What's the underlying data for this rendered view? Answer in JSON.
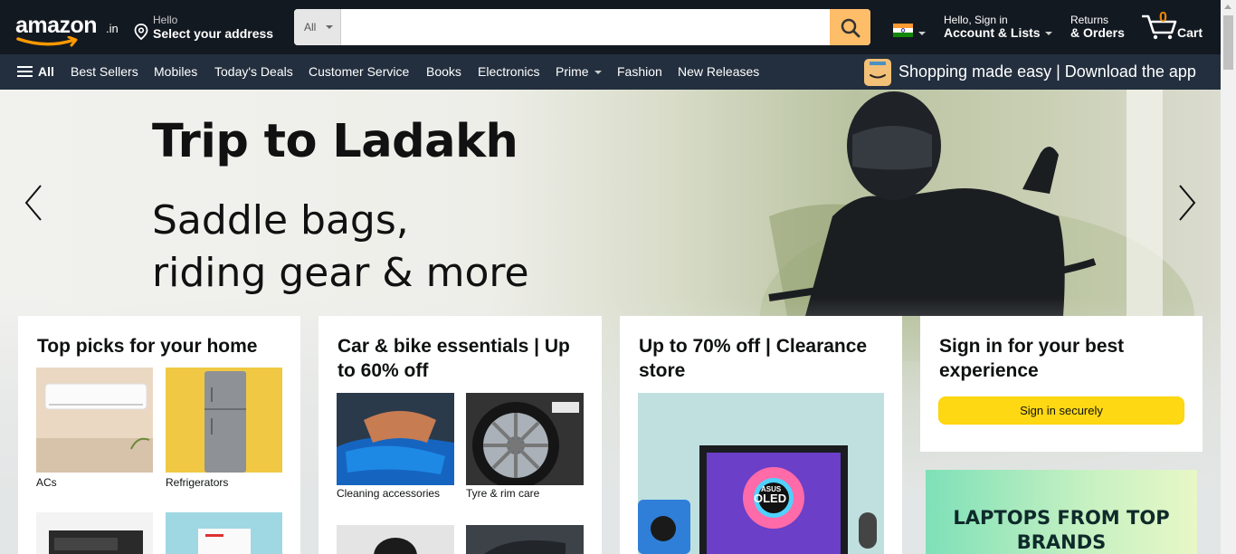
{
  "header": {
    "logo_text": "amazon",
    "logo_tld": ".in",
    "address": {
      "line1": "Hello",
      "line2": "Select your address"
    },
    "search": {
      "category": "All",
      "placeholder": "",
      "value": ""
    },
    "account": {
      "line1": "Hello, Sign in",
      "line2": "Account & Lists"
    },
    "returns": {
      "line1": "Returns",
      "line2": "& Orders"
    },
    "cart": {
      "count": "0",
      "label": "Cart"
    },
    "colors": {
      "bg": "#131921",
      "search_button": "#febd69",
      "cart_count": "#f08804"
    }
  },
  "subnav": {
    "all_label": "All",
    "items": [
      "Best Sellers",
      "Mobiles",
      "Today's Deals",
      "Customer Service",
      "Books",
      "Electronics",
      "Prime",
      "Fashion",
      "New Releases"
    ],
    "promo": "Shopping made easy | Download the app"
  },
  "hero": {
    "title": "Trip to Ladakh",
    "subtitle_line1": "Saddle bags,",
    "subtitle_line2": "riding gear & more"
  },
  "cards": [
    {
      "title": "Top picks for your home",
      "tiles": [
        {
          "caption": "ACs",
          "icon": "air-conditioner"
        },
        {
          "caption": "Refrigerators",
          "icon": "refrigerator"
        },
        {
          "caption": "",
          "icon": "microwave"
        },
        {
          "caption": "",
          "icon": "washing-machine"
        }
      ]
    },
    {
      "title": "Car & bike essentials | Up to 60% off",
      "tiles": [
        {
          "caption": "Cleaning accessories",
          "icon": "car-cleaning"
        },
        {
          "caption": "Tyre & rim care",
          "icon": "tyre-rim"
        },
        {
          "caption": "",
          "icon": "helmet"
        },
        {
          "caption": "",
          "icon": "car-seat"
        }
      ]
    },
    {
      "title": "Up to 70% off | Clearance store",
      "image_badge": "OLED",
      "image_brand": "ASUS"
    },
    {
      "title": "Sign in for your best experience",
      "button": "Sign in securely"
    }
  ],
  "ad": {
    "text": "LAPTOPS FROM TOP BRANDS"
  }
}
